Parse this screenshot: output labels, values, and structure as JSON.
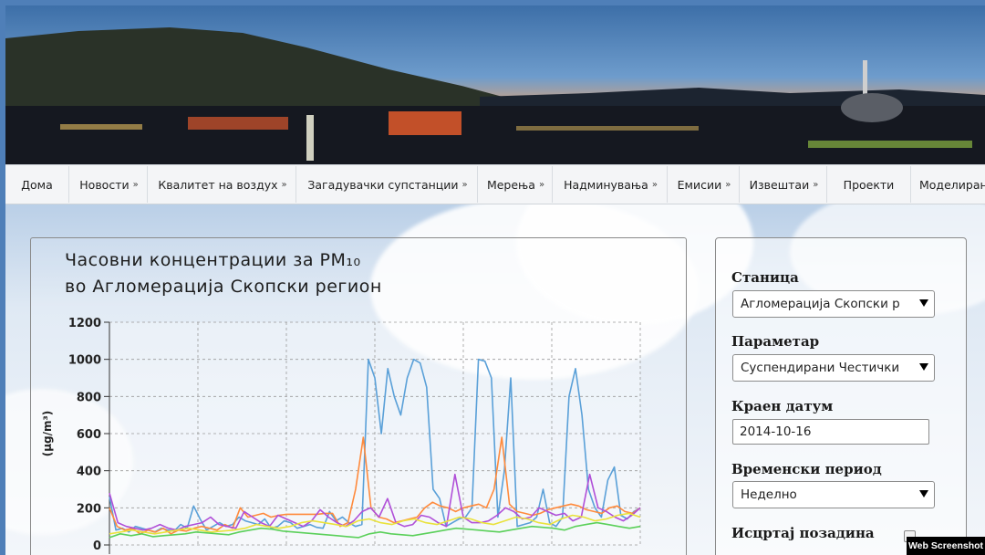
{
  "nav": {
    "items": [
      {
        "label": "Дома",
        "dropdown": false
      },
      {
        "label": "Новости",
        "dropdown": true
      },
      {
        "label": "Квалитет на воздух",
        "dropdown": true
      },
      {
        "label": "Загадувачки супстанции",
        "dropdown": true
      },
      {
        "label": "Мерења",
        "dropdown": true
      },
      {
        "label": "Надминувања",
        "dropdown": true
      },
      {
        "label": "Емисии",
        "dropdown": true
      },
      {
        "label": "Извештаи",
        "dropdown": true
      },
      {
        "label": "Проекти",
        "dropdown": false
      },
      {
        "label": "Моделиран",
        "dropdown": false
      }
    ],
    "chevron": "»"
  },
  "chart": {
    "title_line1": "Часовни концентрации за PM₁₀",
    "title_line2": "во Агломерација Скопски регион"
  },
  "chart_data": {
    "type": "line",
    "ylabel": "(µg/m³)",
    "ylim": [
      0,
      1200
    ],
    "yticks": [
      0,
      200,
      400,
      600,
      800,
      1000,
      1200
    ],
    "grid": true,
    "series": [
      {
        "color": "#5aa0d8",
        "values": [
          260,
          80,
          90,
          70,
          100,
          90,
          80,
          70,
          90,
          80,
          75,
          110,
          90,
          210,
          140,
          80,
          100,
          120,
          100,
          110,
          150,
          130,
          120,
          110,
          140,
          90,
          100,
          130,
          120,
          90,
          100,
          110,
          95,
          90,
          180,
          130,
          150,
          120,
          100,
          110,
          1000,
          900,
          600,
          950,
          800,
          700,
          900,
          1000,
          980,
          850,
          300,
          250,
          100,
          120,
          140,
          150,
          200,
          1000,
          990,
          900,
          150,
          400,
          900,
          100,
          110,
          120,
          150,
          300,
          120,
          100,
          150,
          800,
          950,
          700,
          300,
          200,
          150,
          350,
          420,
          160,
          140,
          180,
          200
        ]
      },
      {
        "color": "#ff8a3c",
        "values": [
          200,
          100,
          80,
          90,
          60,
          80,
          70,
          90,
          60,
          80,
          75,
          90,
          100,
          90,
          80,
          110,
          90,
          200,
          150,
          160,
          170,
          150,
          160,
          165,
          165,
          165,
          165,
          165,
          170,
          170,
          100,
          120,
          300,
          580,
          200,
          150,
          140,
          120,
          130,
          140,
          150,
          200,
          230,
          210,
          200,
          180,
          200,
          210,
          220,
          200,
          300,
          580,
          220,
          180,
          170,
          160,
          170,
          190,
          200,
          210,
          220,
          210,
          190,
          180,
          170,
          200,
          210,
          180,
          170,
          200
        ]
      },
      {
        "color": "#b04fd8",
        "values": [
          280,
          120,
          100,
          90,
          80,
          90,
          110,
          90,
          80,
          100,
          110,
          120,
          150,
          110,
          100,
          90,
          180,
          150,
          120,
          100,
          160,
          140,
          120,
          100,
          130,
          190,
          150,
          120,
          100,
          130,
          180,
          200,
          150,
          250,
          120,
          100,
          110,
          160,
          150,
          120,
          100,
          380,
          150,
          120,
          120,
          130,
          160,
          200,
          180,
          140,
          150,
          200,
          180,
          160,
          170,
          130,
          150,
          380,
          200,
          180,
          150,
          130,
          160,
          200
        ]
      },
      {
        "color": "#e9e23c",
        "values": [
          60,
          70,
          80,
          70,
          60,
          70,
          80,
          90,
          80,
          70,
          75,
          80,
          90,
          110,
          100,
          90,
          100,
          120,
          130,
          120,
          110,
          100,
          130,
          140,
          120,
          110,
          130,
          140,
          120,
          110,
          130,
          150,
          140,
          120,
          110,
          130,
          150,
          140,
          120,
          110,
          140,
          160,
          150,
          130,
          140,
          160,
          170,
          150
        ]
      },
      {
        "color": "#5bd05a",
        "values": [
          40,
          60,
          50,
          60,
          45,
          50,
          55,
          60,
          70,
          65,
          60,
          55,
          70,
          80,
          90,
          85,
          75,
          70,
          65,
          60,
          55,
          50,
          45,
          40,
          60,
          70,
          60,
          55,
          50,
          60,
          70,
          80,
          90,
          85,
          80,
          75,
          70,
          80,
          90,
          100,
          95,
          90,
          80,
          100,
          110,
          120,
          110,
          100,
          90,
          100
        ]
      }
    ]
  },
  "form": {
    "station_label": "Станица",
    "station_value": "Агломерација Скопски р",
    "parameter_label": "Параметар",
    "parameter_value": "Суспендирани Честички",
    "end_date_label": "Краен датум",
    "end_date_value": "2014-10-16",
    "period_label": "Временски период",
    "period_value": "Неделно",
    "background_label": "Исцртај позадина"
  },
  "watermark": "Web Screenshot"
}
